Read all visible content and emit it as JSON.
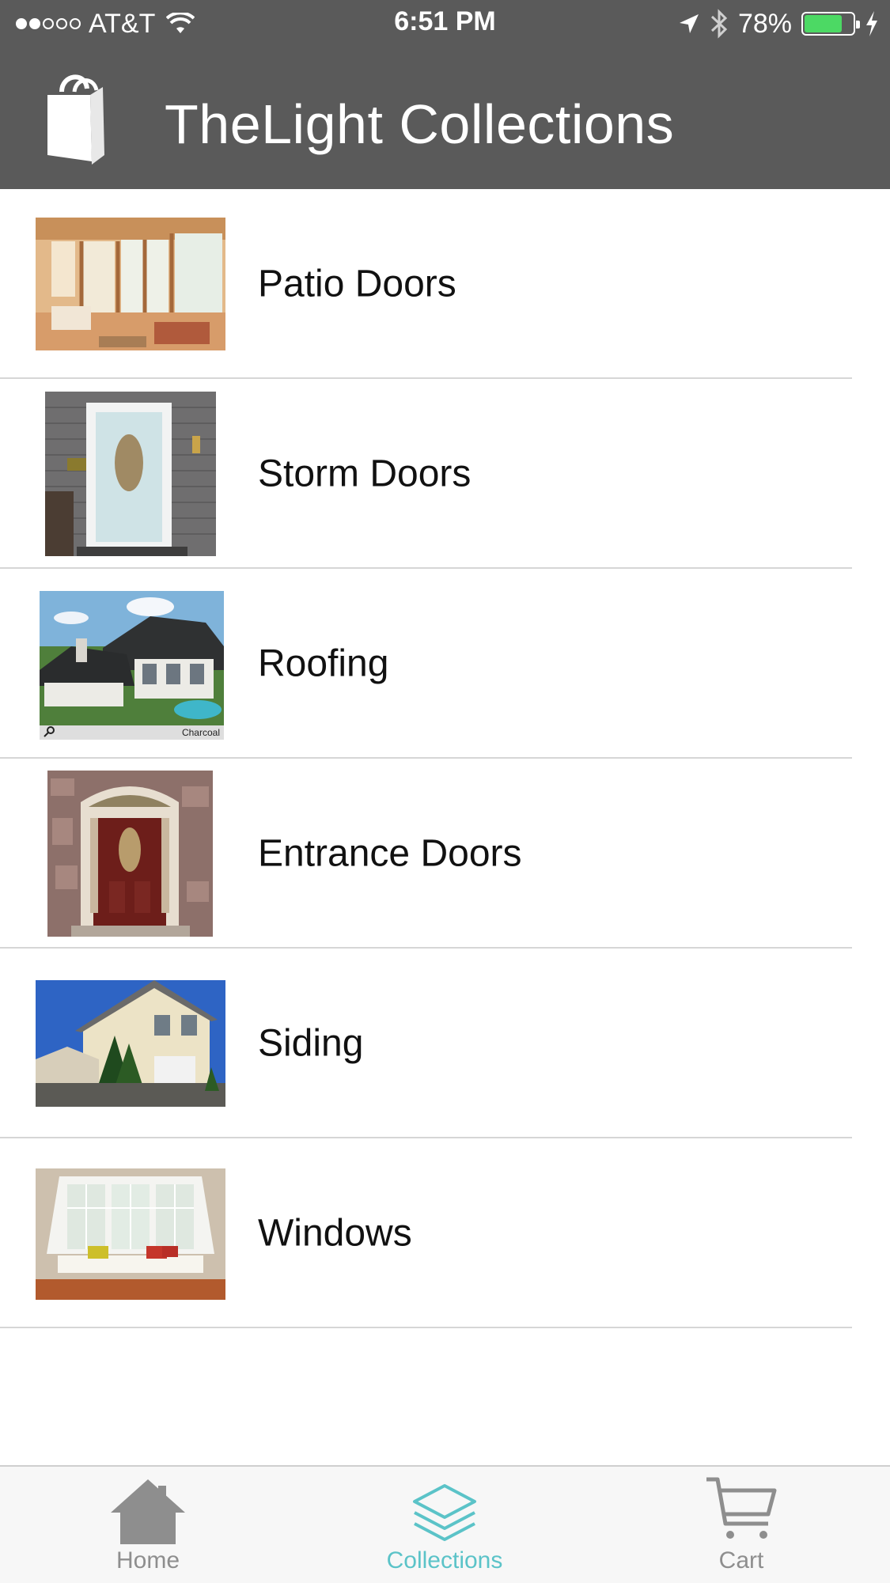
{
  "status_bar": {
    "carrier": "AT&T",
    "time": "6:51 PM",
    "battery": "78%",
    "battery_level": 0.78,
    "signal_bars_filled": 2,
    "signal_bars_total": 5,
    "icons": [
      "wifi-icon",
      "location-arrow-icon",
      "bluetooth-icon",
      "battery-icon",
      "charging-bolt-icon"
    ]
  },
  "header": {
    "title": "TheLight Collections",
    "logo_icon": "shopping-bag-icon"
  },
  "collections": [
    {
      "label": "Patio Doors",
      "image": "patio-doors-photo"
    },
    {
      "label": "Storm Doors",
      "image": "storm-door-photo"
    },
    {
      "label": "Roofing",
      "image": "roofing-photo",
      "image_caption": "Charcoal"
    },
    {
      "label": "Entrance Doors",
      "image": "entrance-door-photo"
    },
    {
      "label": "Siding",
      "image": "siding-photo"
    },
    {
      "label": "Windows",
      "image": "windows-photo"
    }
  ],
  "tabbar": {
    "tabs": [
      {
        "label": "Home",
        "icon": "home-icon",
        "active": false
      },
      {
        "label": "Collections",
        "icon": "layers-icon",
        "active": true
      },
      {
        "label": "Cart",
        "icon": "cart-icon",
        "active": false
      }
    ],
    "active_color": "#5bc3c8",
    "inactive_color": "#8e8e8e"
  },
  "colors": {
    "header_bg": "#5a5a5a",
    "separator": "#d6d6d6"
  }
}
